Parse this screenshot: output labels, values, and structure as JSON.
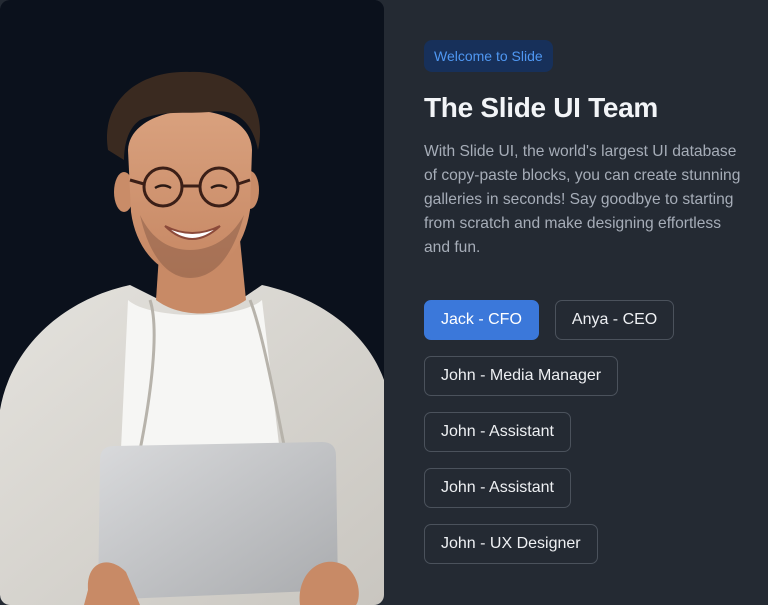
{
  "badge": "Welcome to Slide",
  "title": "The Slide UI Team",
  "description": "With Slide UI, the world's largest UI database of copy-paste blocks, you can create stunning galleries in seconds! Say goodbye to starting from scratch and make designing effortless and fun.",
  "team": [
    {
      "label": "Jack - CFO",
      "selected": true
    },
    {
      "label": "Anya - CEO",
      "selected": false
    },
    {
      "label": "John - Media Manager",
      "selected": false
    },
    {
      "label": "John - Assistant",
      "selected": false
    },
    {
      "label": "John - Assistant",
      "selected": false
    },
    {
      "label": "John - UX Designer",
      "selected": false
    }
  ],
  "colors": {
    "accent": "#3b78da",
    "badge_text": "#4f97f2",
    "badge_bg": "#17305a",
    "panel_bg": "#242a33",
    "photo_bg": "#0b111c"
  }
}
